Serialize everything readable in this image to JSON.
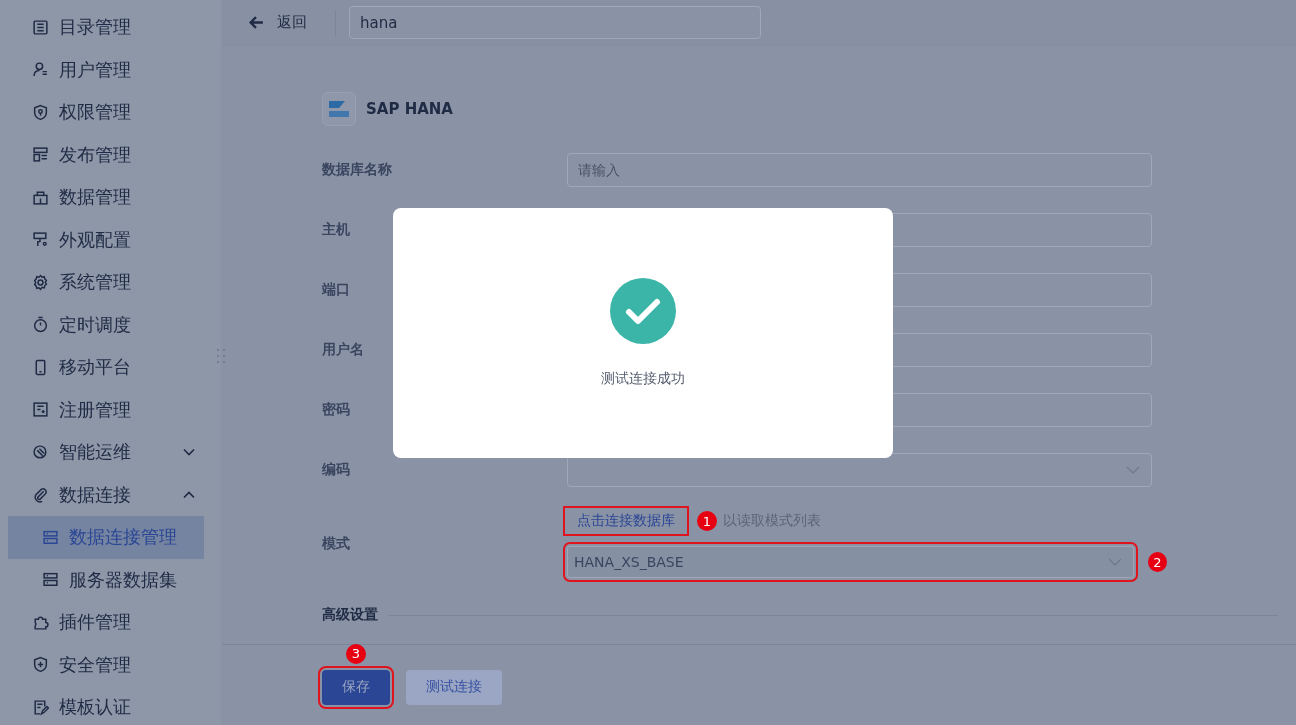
{
  "sidebar": {
    "items": [
      {
        "label": "目录管理",
        "selected": false
      },
      {
        "label": "用户管理",
        "selected": false
      },
      {
        "label": "权限管理",
        "selected": false
      },
      {
        "label": "发布管理",
        "selected": false
      },
      {
        "label": "数据管理",
        "selected": false
      },
      {
        "label": "外观配置",
        "selected": false
      },
      {
        "label": "系统管理",
        "selected": false
      },
      {
        "label": "定时调度",
        "selected": false
      },
      {
        "label": "移动平台",
        "selected": false
      },
      {
        "label": "注册管理",
        "selected": false
      },
      {
        "label": "智能运维",
        "selected": false,
        "expanded": false
      },
      {
        "label": "数据连接",
        "selected": false,
        "expanded": true,
        "children": [
          {
            "label": "数据连接管理",
            "selected": true
          },
          {
            "label": "服务器数据集",
            "selected": false
          }
        ]
      },
      {
        "label": "插件管理",
        "selected": false
      },
      {
        "label": "安全管理",
        "selected": false
      },
      {
        "label": "模板认证",
        "selected": false
      }
    ]
  },
  "topbar": {
    "back": "返回",
    "search": {
      "value": "hana"
    }
  },
  "form": {
    "title": "SAP HANA",
    "fields": [
      {
        "label": "数据库名称",
        "kind": "input",
        "placeholder": "请输入"
      },
      {
        "label": "主机",
        "kind": "input"
      },
      {
        "label": "端口",
        "kind": "input"
      },
      {
        "label": "用户名",
        "kind": "input"
      },
      {
        "label": "密码",
        "kind": "input"
      },
      {
        "label": "编码",
        "kind": "select"
      }
    ],
    "schema": {
      "label": "模式",
      "link": "点击连接数据库",
      "hint": "以读取模式列表",
      "value": "HANA_XS_BASE"
    },
    "advanced": "高级设置"
  },
  "footer": {
    "buttons": [
      {
        "label": "保存",
        "kind": "primary"
      },
      {
        "label": "测试连接",
        "kind": "secondary"
      }
    ]
  },
  "markers": {
    "link": "1",
    "schema": "2",
    "save": "3"
  },
  "dialog": {
    "message": "测试连接成功"
  }
}
